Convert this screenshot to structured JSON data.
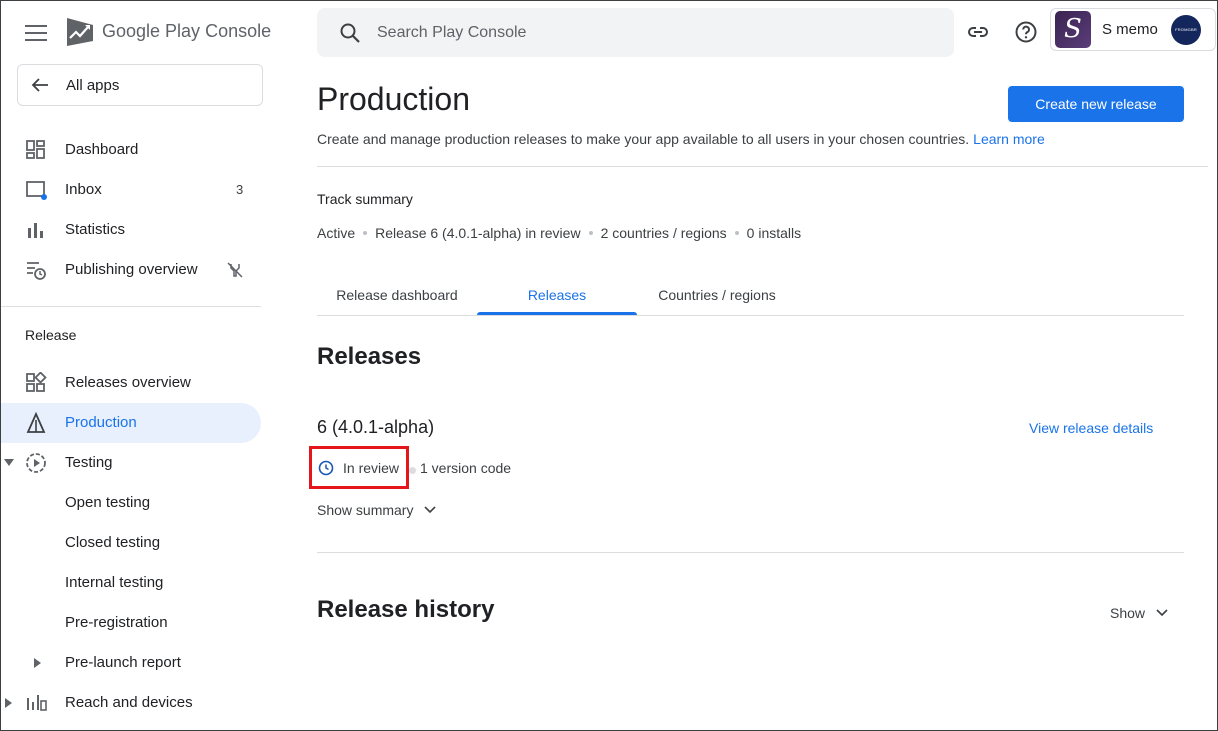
{
  "app": {
    "logo_text_google": "Google Play",
    "logo_text_console": "Console",
    "back_label": "All apps"
  },
  "search": {
    "placeholder": "Search Play Console"
  },
  "account": {
    "app_name": "S memo",
    "developer_badge_text": "FROMGBR"
  },
  "sidebar": {
    "items": [
      {
        "label": "Dashboard",
        "icon": "dashboard-icon"
      },
      {
        "label": "Inbox",
        "icon": "inbox-icon",
        "count": "3"
      },
      {
        "label": "Statistics",
        "icon": "bar-chart-icon"
      },
      {
        "label": "Publishing overview",
        "icon": "publishing-overview-icon"
      }
    ],
    "release_section": "Release",
    "release_items": [
      {
        "label": "Releases overview"
      },
      {
        "label": "Production"
      },
      {
        "label": "Testing"
      },
      {
        "label": "Open testing"
      },
      {
        "label": "Closed testing"
      },
      {
        "label": "Internal testing"
      },
      {
        "label": "Pre-registration"
      },
      {
        "label": "Pre-launch report"
      },
      {
        "label": "Reach and devices"
      }
    ]
  },
  "page": {
    "title": "Production",
    "create_button": "Create new release",
    "subtitle": "Create and manage production releases to make your app available to all users in your chosen countries.",
    "learn_more": "Learn more",
    "track_summary_title": "Track summary",
    "track_summary": [
      "Active",
      "Release 6 (4.0.1-alpha) in review",
      "2 countries / regions",
      "0 installs"
    ],
    "tabs": [
      {
        "label": "Release dashboard"
      },
      {
        "label": "Releases"
      },
      {
        "label": "Countries / regions"
      }
    ],
    "active_tab": "Releases",
    "releases_heading": "Releases",
    "release": {
      "name": "6 (4.0.1-alpha)",
      "view_details": "View release details",
      "status": "In review",
      "version_codes": "1 version code",
      "show_summary": "Show summary"
    },
    "history_heading": "Release history",
    "history_show": "Show"
  },
  "colors": {
    "accent": "#1a73e8",
    "highlight_box": "#e5161b",
    "active_nav_bg": "#e8f0fe"
  }
}
